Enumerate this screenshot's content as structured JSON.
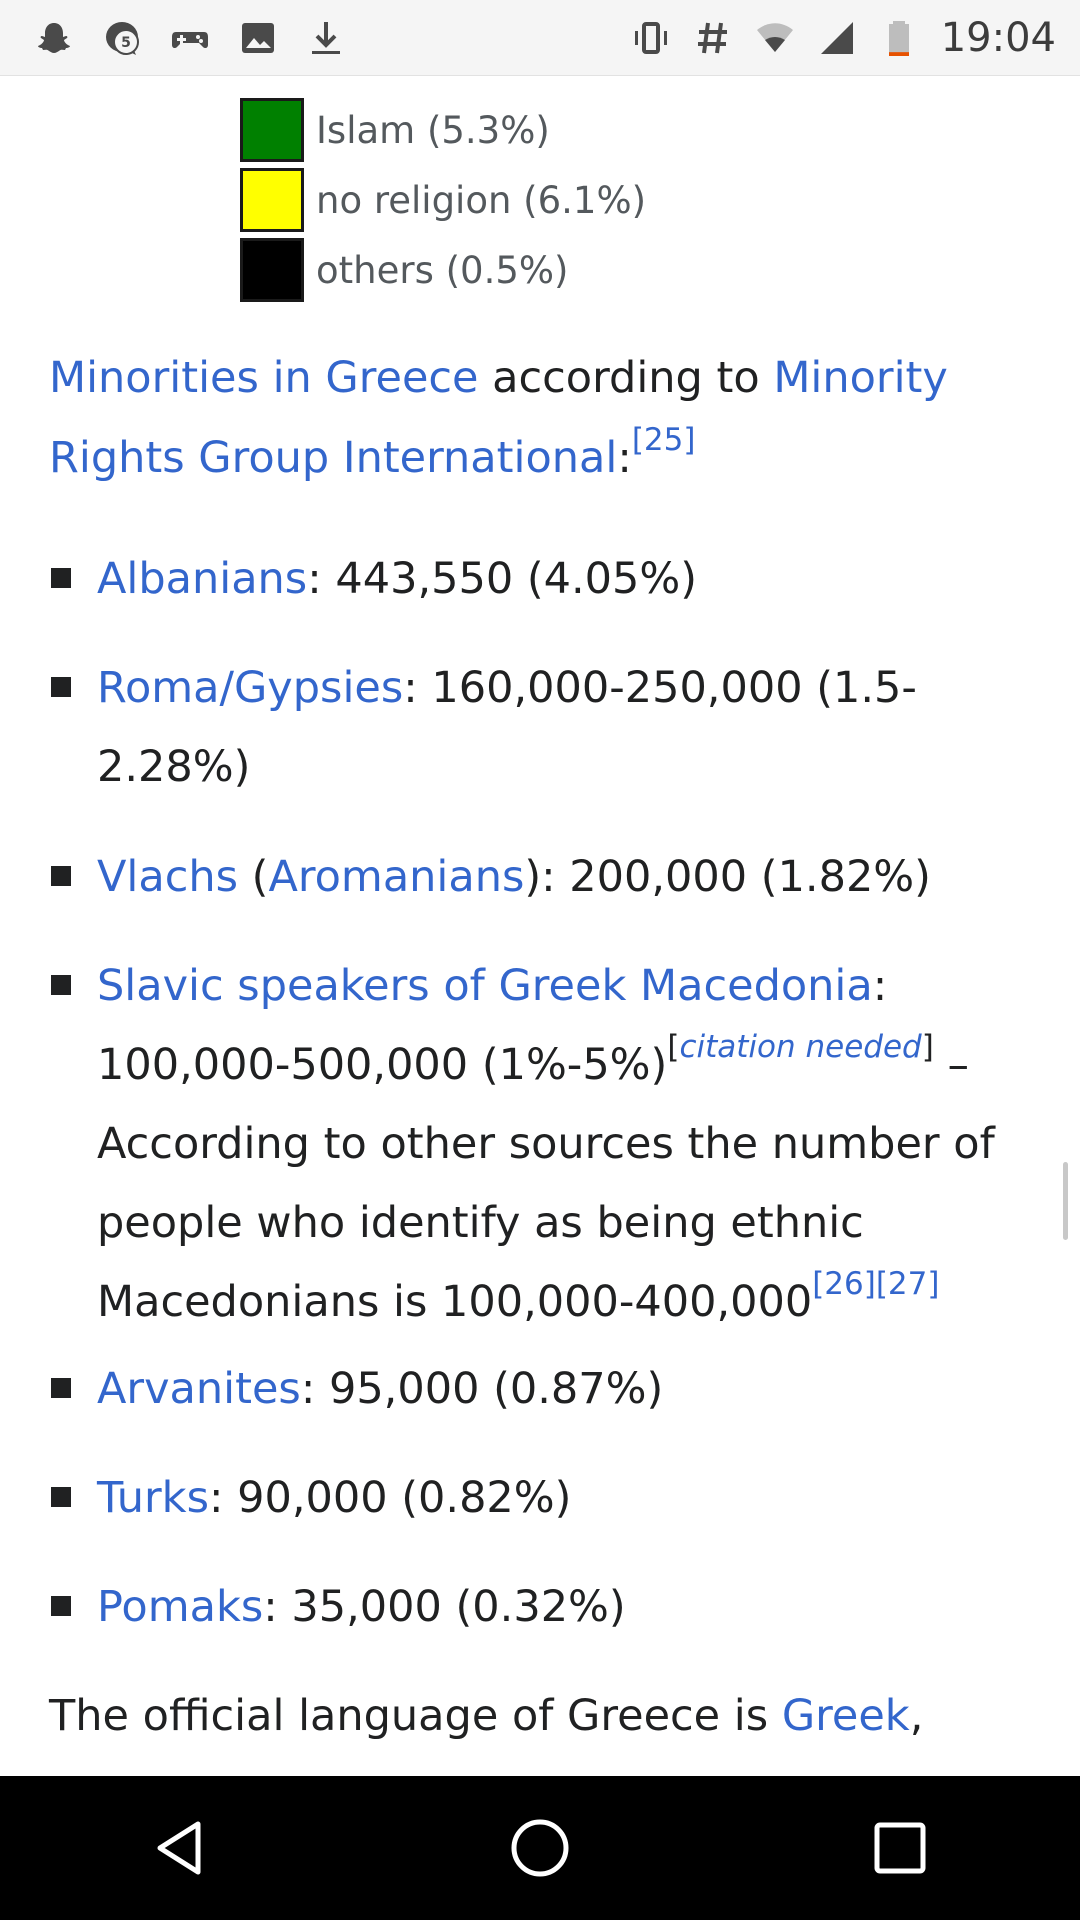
{
  "status_bar": {
    "time": "19:04",
    "notification_badge": "5",
    "left_icons": [
      "snapchat-icon",
      "chat-bubble-icon",
      "gamepad-icon",
      "image-icon",
      "download-icon"
    ],
    "right_icons": [
      "vibrate-icon",
      "hash-icon",
      "wifi-icon",
      "cellular-signal-icon",
      "battery-icon"
    ],
    "battery_level": 0.12,
    "battery_color": "#e65100"
  },
  "legend": {
    "items": [
      {
        "label": "Islam (5.3%)",
        "color": "#008000"
      },
      {
        "label": "no religion (6.1%)",
        "color": "#ffff00"
      },
      {
        "label": "others (0.5%)",
        "color": "#000000"
      }
    ]
  },
  "intro": {
    "link1": "Minorities in Greece",
    "text1": " according to ",
    "link2": "Minority Rights Group International",
    "text2": ":",
    "ref": "[25]"
  },
  "minorities": [
    {
      "link": "Albanians",
      "text": ": 443,550 (4.05%)"
    },
    {
      "link": "Roma/Gypsies",
      "text": ": 160,000-250,000 (1.5-2.28%)"
    },
    {
      "link": "Vlachs",
      "text_a": " (",
      "link2": "Aromanians",
      "text": "): 200,000 (1.82%)"
    },
    {
      "link": "Slavic speakers of Greek Macedonia",
      "text": ": 100,000-500,000 (1%-5%)",
      "cite_open": "[",
      "cite_needed": "citation needed",
      "cite_close": "]",
      "text_b": " – According to other sources the number of people who identify as being ethnic Macedonians is 100,000-400,000",
      "refs": "[26][27]"
    },
    {
      "link": "Arvanites",
      "text": ": 95,000 (0.87%)"
    },
    {
      "link": "Turks",
      "text": ": 90,000 (0.82%)"
    },
    {
      "link": "Pomaks",
      "text": ": 35,000 (0.32%)"
    }
  ],
  "outro": {
    "text": "The official language of Greece is ",
    "link": "Greek",
    "text_end": ","
  },
  "nav_bar": {
    "buttons": [
      "back-icon",
      "home-icon",
      "recents-icon"
    ]
  }
}
